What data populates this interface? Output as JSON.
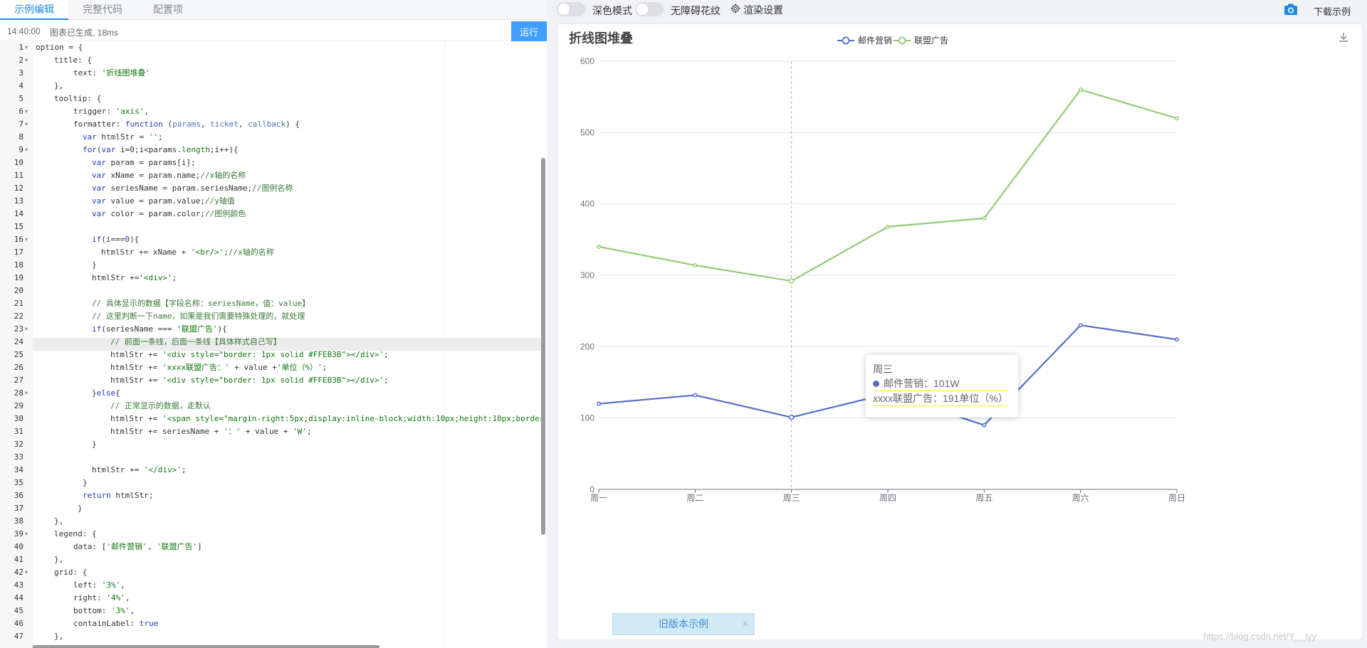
{
  "tabs": [
    {
      "label": "示例编辑",
      "active": true
    },
    {
      "label": "完整代码",
      "active": false
    },
    {
      "label": "配置项",
      "active": false
    }
  ],
  "status": {
    "time": "14:40:00",
    "message": "图表已生成, 18ms"
  },
  "run_button": "运行",
  "editor": {
    "line_numbers": [
      "1",
      "2",
      "3",
      "4",
      "5",
      "6",
      "7",
      "8",
      "9",
      "10",
      "11",
      "12",
      "13",
      "14",
      "15",
      "16",
      "17",
      "18",
      "19",
      "20",
      "21",
      "22",
      "23",
      "24",
      "25",
      "26",
      "27",
      "28",
      "29",
      "30",
      "31",
      "32",
      "33",
      "34",
      "35",
      "36",
      "37",
      "38",
      "39",
      "40",
      "41",
      "42",
      "43",
      "44",
      "45",
      "46",
      "47"
    ],
    "active_line": 26
  },
  "toolbar": {
    "dark_mode": "深色模式",
    "a11y_pattern": "无障碍花纹",
    "render_settings": "渲染设置",
    "download_example": "下载示例",
    "icons": [
      "gear-icon",
      "camera-icon"
    ]
  },
  "old_version": {
    "label": "旧版本示例",
    "close": "×"
  },
  "watermark": "https://blog.csdn.net/Y__lyy",
  "tooltip": {
    "title": "周三",
    "row1": "邮件营销：101W",
    "row2": "xxxx联盟广告：191单位（%）",
    "divider_color": "#FFEB3B"
  },
  "chart_data": {
    "type": "line",
    "title": "折线图堆叠",
    "categories": [
      "周一",
      "周二",
      "周三",
      "周四",
      "周五",
      "周六",
      "周日"
    ],
    "series": [
      {
        "name": "邮件营销",
        "values": [
          120,
          132,
          101,
          134,
          90,
          230,
          210
        ],
        "color": "#5470c6"
      },
      {
        "name": "联盟广告",
        "values": [
          340,
          314,
          292,
          368,
          380,
          560,
          520
        ],
        "color": "#91cc75"
      }
    ],
    "y_ticks": [
      "0",
      "100",
      "200",
      "300",
      "400",
      "500",
      "600"
    ],
    "ylim": [
      0,
      600
    ],
    "legend_position": "top-center",
    "grid": true,
    "axis_pointer_index": 2
  }
}
